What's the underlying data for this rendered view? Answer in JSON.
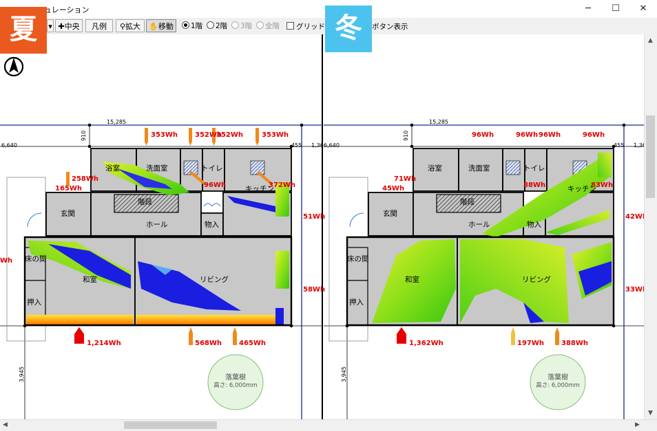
{
  "window": {
    "title": "ュレーション",
    "controls": {
      "minimize": "─",
      "maximize": "☐",
      "close": "✕"
    }
  },
  "toolbar": {
    "center_label": "中央",
    "legend_label": "凡例",
    "zoom_label": "拡大",
    "move_label": "移動",
    "floor1_label": "1階",
    "floor2_label": "2階",
    "floor3_label": "3階",
    "all_label": "全階",
    "grid_label": "グリッド線",
    "btn_display_label": "ボタン表示"
  },
  "badges": {
    "summer": "夏",
    "winter": "冬"
  },
  "colors": {
    "summer_badge": "#ea5a1e",
    "winter_badge": "#4cc3ef",
    "energy_text": "#e00000",
    "room_fill": "#c8c8c8"
  },
  "plan": {
    "rooms": {
      "bath": "浴室",
      "washroom": "洗面室",
      "toilet": "トイレ",
      "kitchen": "キッチン",
      "stairs": "階段",
      "entrance": "玄関",
      "hall": "ホール",
      "storage": "物入",
      "tokonoma": "床の間",
      "washitsu": "和室",
      "living": "リビング",
      "closet": "押入"
    },
    "dimensions": {
      "width": "15,285",
      "top": "910",
      "left": "6,640",
      "right_a": "455",
      "right_b": "1,36",
      "bottom": "3,945"
    },
    "tree": {
      "label": "落葉樹",
      "height": "高さ: 6,000mm"
    }
  },
  "summer": {
    "top": [
      "353Wh",
      "352Wh",
      "352Wh",
      "353Wh"
    ],
    "upper_left": "258Wh",
    "left_mid": "165Wh",
    "toilet_inner": "96Wh",
    "kitchen_inner": "372Wh",
    "right_upper": "51Wh",
    "right_lower": "58Wh",
    "left_edge": "Wh",
    "bottom": [
      "1,214Wh",
      "568Wh",
      "465Wh"
    ]
  },
  "winter": {
    "top": [
      "96Wh",
      "96Wh",
      "96Wh",
      "96Wh"
    ],
    "upper_left": "71Wh",
    "left_mid": "45Wh",
    "toilet_inner": "88Wh",
    "kitchen_inner": "83Wh",
    "right_upper": "42Wh",
    "right_lower": "33Wh",
    "bottom": [
      "1,362Wh",
      "197Wh",
      "388Wh"
    ]
  }
}
